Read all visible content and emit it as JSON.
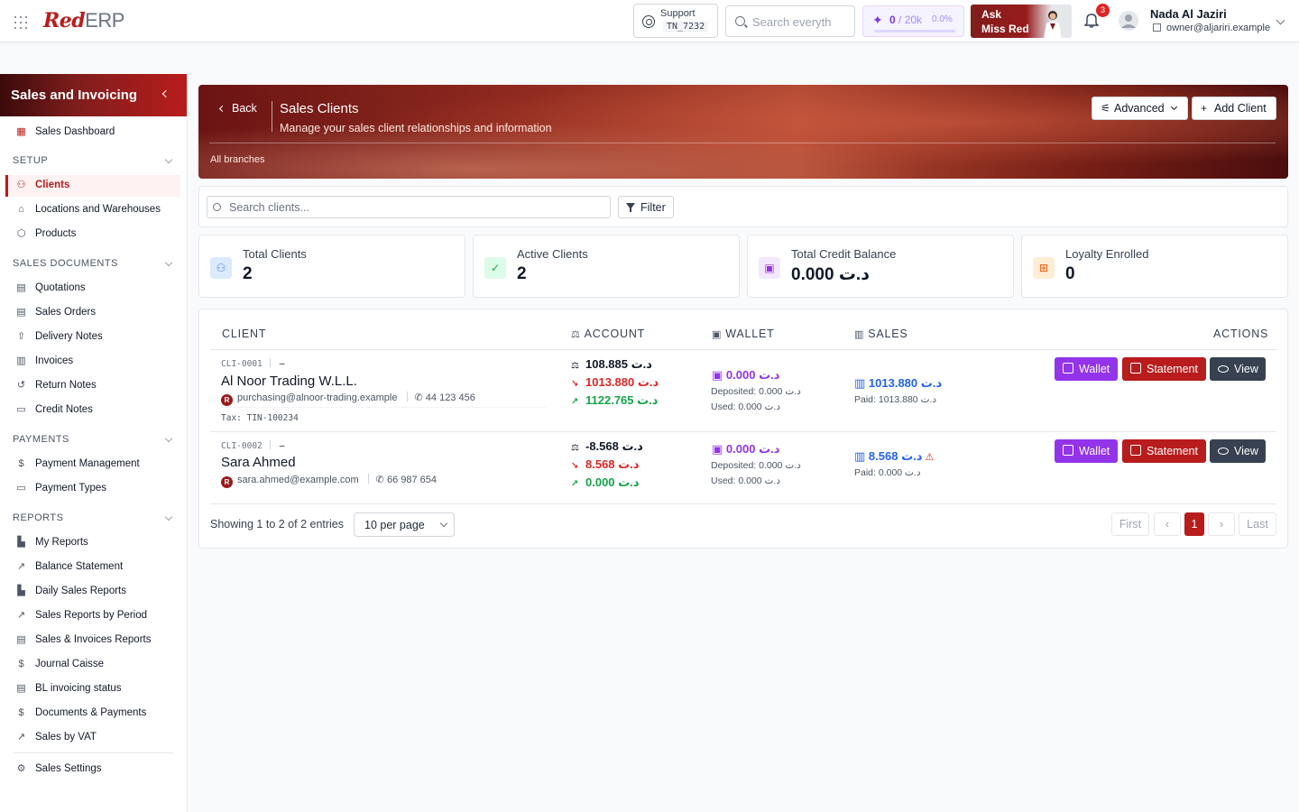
{
  "app": {
    "logo_red": "Red",
    "logo_erp": "ERP"
  },
  "topbar": {
    "support_label": "Support",
    "support_code": "TN_7232",
    "search_placeholder": "Search everyth",
    "usage_value": "0",
    "usage_limit": "/ 20k",
    "usage_pct": "0.0%",
    "ask_line1": "Ask",
    "ask_line2": "Miss Red",
    "notif_count": "3",
    "user_name": "Nada Al Jaziri",
    "user_email": "owner@aljariri.example"
  },
  "sidebar": {
    "title": "Sales and Invoicing",
    "dashboard": "Sales Dashboard",
    "sections": {
      "setup": "SETUP",
      "sales_documents": "SALES DOCUMENTS",
      "payments": "PAYMENTS",
      "reports": "REPORTS"
    },
    "setup_items": [
      "Clients",
      "Locations and Warehouses",
      "Products"
    ],
    "doc_items": [
      "Quotations",
      "Sales Orders",
      "Delivery Notes",
      "Invoices",
      "Return Notes",
      "Credit Notes"
    ],
    "payment_items": [
      "Payment Management",
      "Payment Types"
    ],
    "report_items": [
      "My Reports",
      "Balance Statement",
      "Daily Sales Reports",
      "Sales Reports by Period",
      "Sales & Invoices Reports",
      "Journal Caisse",
      "BL invoicing status",
      "Documents & Payments",
      "Sales by VAT"
    ],
    "settings": "Sales Settings"
  },
  "header": {
    "back": "Back",
    "title": "Sales Clients",
    "subtitle": "Manage your sales client relationships and information",
    "branches": "All branches",
    "advanced": "Advanced",
    "add_client": "Add Client"
  },
  "search": {
    "placeholder": "Search clients...",
    "filter": "Filter"
  },
  "stats": [
    {
      "label": "Total Clients",
      "value": "2",
      "color": "#3b82f6"
    },
    {
      "label": "Active Clients",
      "value": "2",
      "color": "#16a34a"
    },
    {
      "label": "Total Credit Balance",
      "value": "0.000 د.ت",
      "color": "#9333ea"
    },
    {
      "label": "Loyalty Enrolled",
      "value": "0",
      "color": "#ea580c"
    }
  ],
  "table": {
    "headers": {
      "client": "CLIENT",
      "account": "ACCOUNT",
      "wallet": "WALLET",
      "sales": "SALES",
      "actions": "ACTIONS"
    },
    "rows": [
      {
        "id": "CLI-0001",
        "dash": "—",
        "name": "Al Noor Trading W.L.L.",
        "email": "purchasing@alnoor-trading.example",
        "phone": "44 123 456",
        "tax": "Tax: TIN-100234",
        "balance": "108.885 د.ت",
        "debit": "1013.880 د.ت",
        "credit": "1122.765 د.ت",
        "wallet": "0.000 د.ت",
        "deposited": "Deposited: 0.000 د.ت",
        "used": "Used: 0.000 د.ت",
        "sales": "1013.880 د.ت",
        "paid": "Paid: 1013.880 د.ت"
      },
      {
        "id": "CLI-0002",
        "dash": "—",
        "name": "Sara Ahmed",
        "email": "sara.ahmed@example.com",
        "phone": "66 987 654",
        "balance": "-8.568 د.ت",
        "debit": "8.568 د.ت",
        "credit": "0.000 د.ت",
        "wallet": "0.000 د.ت",
        "deposited": "Deposited: 0.000 د.ت",
        "used": "Used: 0.000 د.ت",
        "sales": "8.568 د.ت",
        "paid": "Paid: 0.000 د.ت"
      }
    ],
    "actions": {
      "wallet": "Wallet",
      "statement": "Statement",
      "view": "View"
    }
  },
  "footer": {
    "showing": "Showing 1 to 2 of 2 entries",
    "per_page": "10 per page",
    "first": "First",
    "prev": "‹",
    "page": "1",
    "next": "›",
    "last": "Last"
  },
  "colors": {
    "brand": "#b91c1c",
    "wallet": "#9333ea",
    "sales": "#2563eb",
    "positive": "#16a34a",
    "negative": "#dc2626"
  }
}
